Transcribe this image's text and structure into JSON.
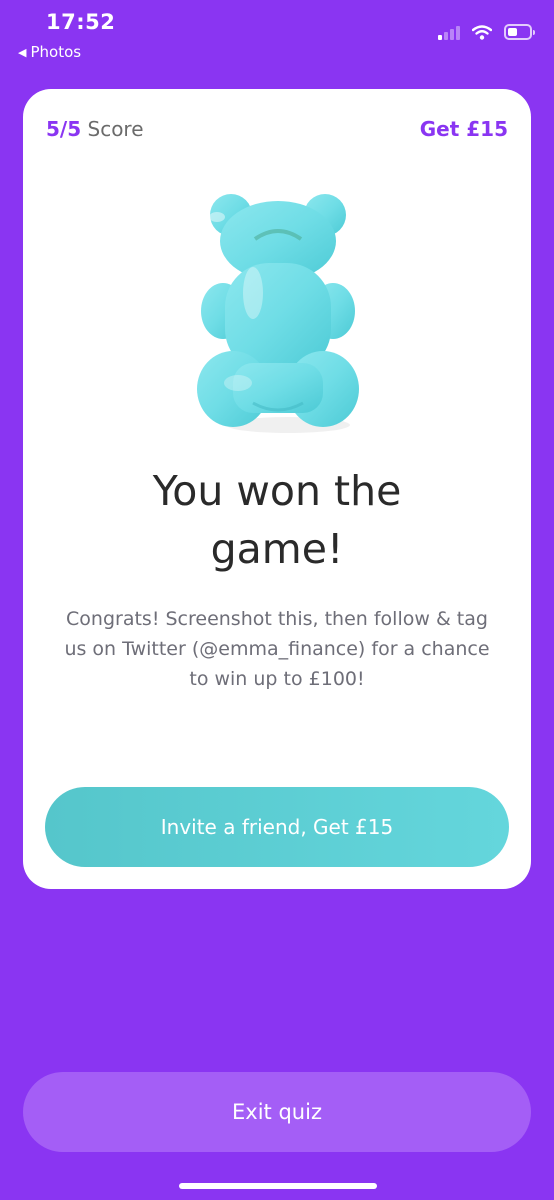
{
  "status_bar": {
    "time": "17:52",
    "back_label": "Photos",
    "signal_bars_active": 1,
    "signal_bars_total": 4,
    "battery_level": 0.45,
    "icons": [
      "signal-icon",
      "wifi-icon",
      "battery-icon"
    ]
  },
  "card": {
    "score_value": "5/5",
    "score_label": "Score",
    "reward_label": "Get £15",
    "image_icon": "gummy-bear-icon",
    "title": "You won the game!",
    "message": "Congrats! Screenshot this, then follow & tag us on Twitter (@emma_finance) for a chance to win up to  £100!",
    "invite_button_label": "Invite a friend, Get £15"
  },
  "exit_button_label": "Exit quiz",
  "colors": {
    "background": "#8a35f2",
    "accent": "#8a35f2",
    "invite_button": "#5ccfd5",
    "exit_button": "#a45ef6",
    "gummy_bear": "#6fdde6"
  }
}
